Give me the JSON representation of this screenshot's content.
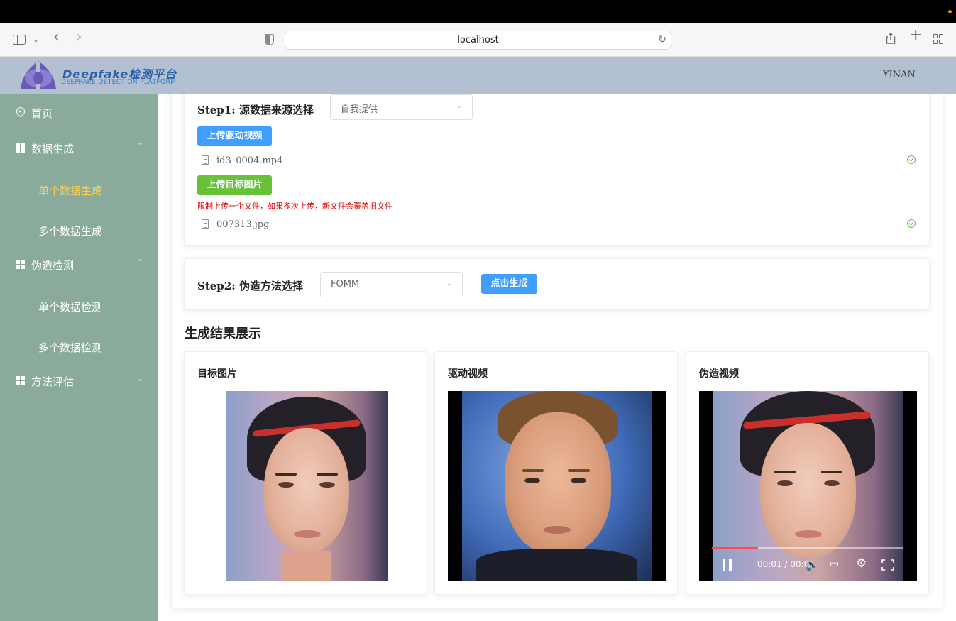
{
  "browser": {
    "url": "localhost"
  },
  "header": {
    "logo_title": "Deepfake检测平台",
    "logo_subtitle": "DEEPFAKE DETECTION PLATFORM",
    "user": "YINAN"
  },
  "sidebar": {
    "home": "首页",
    "data_gen": "数据生成",
    "single_gen": "单个数据生成",
    "multi_gen": "多个数据生成",
    "forgery_detect": "伪造检测",
    "single_detect": "单个数据检测",
    "multi_detect": "多个数据检测",
    "method_eval": "方法评估"
  },
  "step1": {
    "label": "Step1: 源数据来源选择",
    "source_select": "自我提供",
    "upload_video_btn": "上传驱动视频",
    "video_file": "id3_0004.mp4",
    "upload_image_btn": "上传目标图片",
    "warning": "限制上传一个文件，如果多次上传，新文件会覆盖旧文件",
    "image_file": "007313.jpg"
  },
  "step2": {
    "label": "Step2: 伪造方法选择",
    "method_select": "FOMM",
    "generate_btn": "点击生成"
  },
  "results": {
    "title": "生成结果展示",
    "target_image": "目标图片",
    "driving_video": "驱动视频",
    "fake_video": "伪造视频",
    "video_time": "00:01 / 00:06",
    "progress_fraction": 0.24
  },
  "colors": {
    "header_bg": "#b3c0d1",
    "sidebar_bg": "#8aab9c",
    "active_menu": "#ffd04b",
    "primary_button": "#409eff",
    "success_button": "#67c23a",
    "warning_text": "#e00000"
  }
}
